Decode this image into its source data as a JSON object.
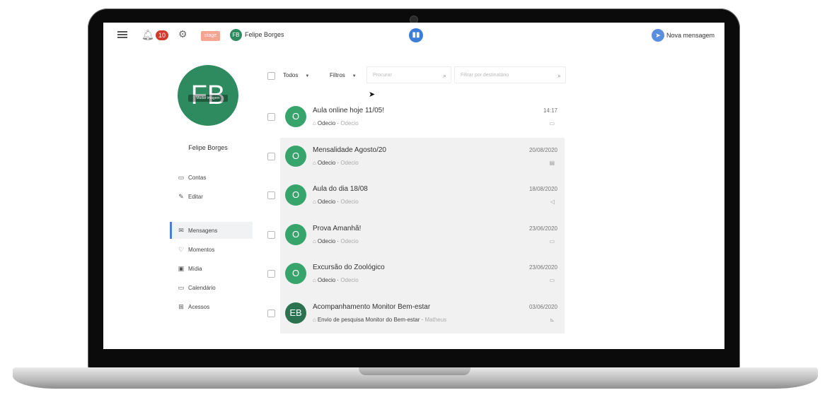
{
  "topbar": {
    "notification_count": "10",
    "stage_tag": "stage",
    "user_initials": "FB",
    "user_name": "Felipe Borges",
    "new_message_label": "Nova mensagem"
  },
  "profile": {
    "initials": "FB",
    "change_image_label": "Mudar imagem",
    "name": "Felipe Borges"
  },
  "sidebar": {
    "items": [
      {
        "label": "Contas",
        "icon": "calendar-icon"
      },
      {
        "label": "Editar",
        "icon": "pencil-icon"
      },
      {
        "label": "Mensagens",
        "icon": "envelope-icon",
        "active": true
      },
      {
        "label": "Momentos",
        "icon": "heart-icon"
      },
      {
        "label": "Mídia",
        "icon": "image-icon"
      },
      {
        "label": "Calendário",
        "icon": "calendar-icon"
      },
      {
        "label": "Acessos",
        "icon": "gift-icon"
      }
    ]
  },
  "filters": {
    "todos_label": "Todos",
    "filtros_label": "Filtros",
    "search_placeholder": "Procurar",
    "recipient_placeholder": "Filtrar por destinatário"
  },
  "messages": [
    {
      "initial": "O",
      "subject": "Aula online hoje 11/05!",
      "sender": "Odecio",
      "sender_sub": "Odecio",
      "date": "14:17",
      "type_icon": "calendar-icon"
    },
    {
      "initial": "O",
      "subject": "Mensalidade Agosto/20",
      "sender": "Odecio",
      "sender_sub": "Odecio",
      "date": "20/08/2020",
      "type_icon": "receipt-icon"
    },
    {
      "initial": "O",
      "subject": "Aula do dia 18/08",
      "sender": "Odecio",
      "sender_sub": "Odecio",
      "date": "18/08/2020",
      "type_icon": "megaphone-icon"
    },
    {
      "initial": "O",
      "subject": "Prova Amanhã!",
      "sender": "Odecio",
      "sender_sub": "Odecio",
      "date": "23/06/2020",
      "type_icon": "calendar-icon"
    },
    {
      "initial": "O",
      "subject": "Excursão do Zoológico",
      "sender": "Odecio",
      "sender_sub": "Odecio",
      "date": "23/06/2020",
      "type_icon": "calendar-icon"
    },
    {
      "initial": "EB",
      "subject": "Acompanhamento Monitor Bem-estar",
      "sender": "Envio de pesquisa Monitor do Bem-estar",
      "sender_sub": "Matheus",
      "date": "03/06/2020",
      "type_icon": "chart-icon"
    }
  ]
}
